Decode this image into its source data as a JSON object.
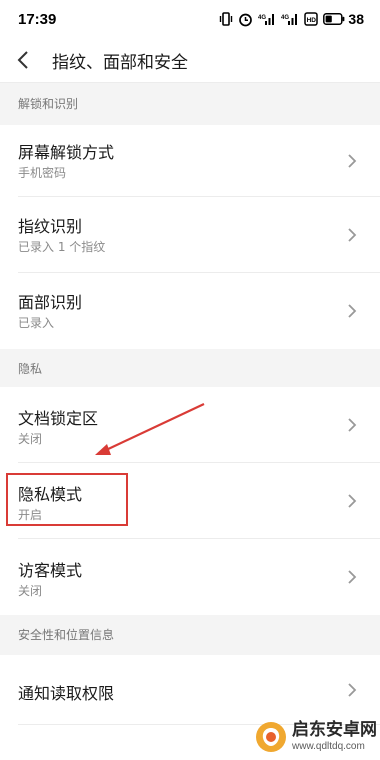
{
  "status_bar": {
    "time": "17:39",
    "battery_level": "38",
    "icons": [
      "vibrate-icon",
      "alarm-icon",
      "signal-icon",
      "signal-icon",
      "hd-icon",
      "battery-icon"
    ]
  },
  "header": {
    "title": "指纹、面部和安全",
    "back_icon": "chevron-left-icon"
  },
  "sections": {
    "unlock": {
      "header": "解锁和识别",
      "items": [
        {
          "title": "屏幕解锁方式",
          "subtitle": "手机密码"
        },
        {
          "title": "指纹识别",
          "subtitle": "已录入 1 个指纹"
        },
        {
          "title": "面部识别",
          "subtitle": "已录入"
        }
      ]
    },
    "privacy": {
      "header": "隐私",
      "items": [
        {
          "title": "文档锁定区",
          "subtitle": "关闭"
        },
        {
          "title": "隐私模式",
          "subtitle": "开启"
        },
        {
          "title": "访客模式",
          "subtitle": "关闭"
        }
      ]
    },
    "security": {
      "header": "安全性和位置信息",
      "items": [
        {
          "title": "通知读取权限"
        }
      ]
    }
  },
  "annotation": {
    "color": "#d93b36"
  },
  "watermark": {
    "text": "启东安卓网",
    "url": "www.qdltdq.com"
  }
}
